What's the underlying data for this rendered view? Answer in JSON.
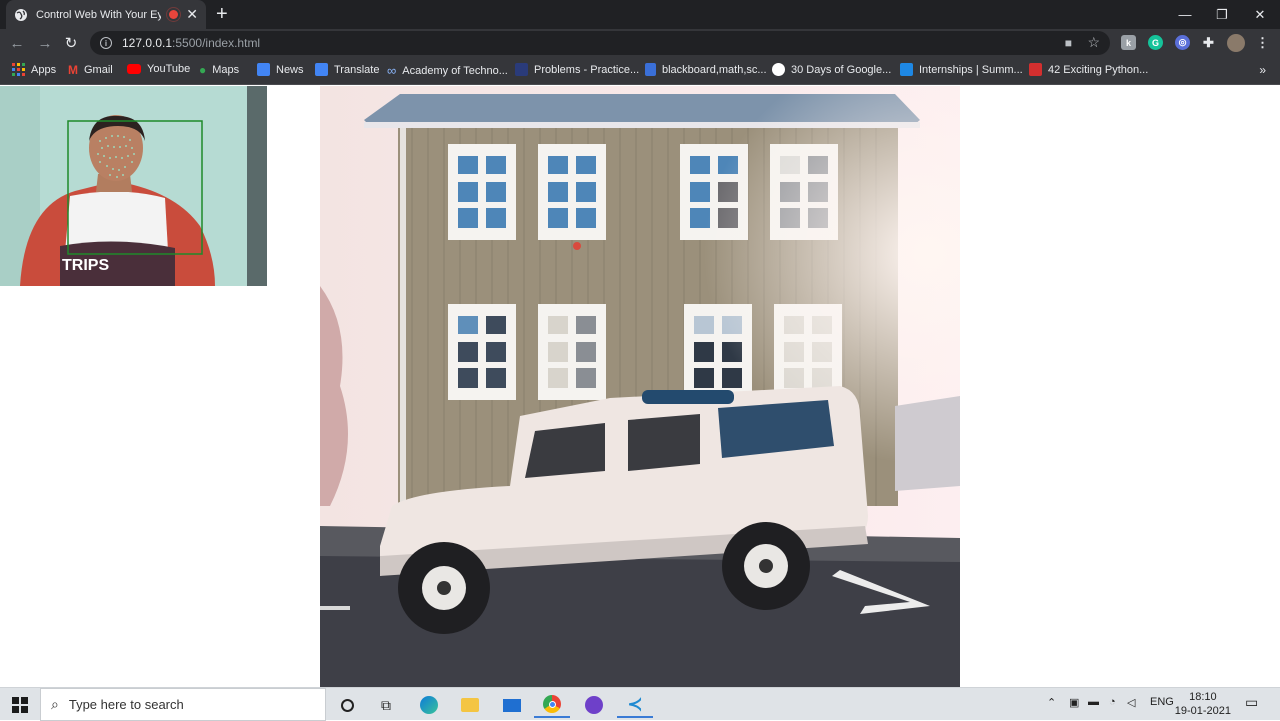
{
  "browser": {
    "tab_title": "Control Web With Your Eyes",
    "url_host": "127.0.0.1",
    "url_rest": ":5500/index.html",
    "bookmarks": [
      {
        "label": "Apps",
        "color": "#4285f4"
      },
      {
        "label": "Gmail",
        "color": "#ea4335"
      },
      {
        "label": "YouTube",
        "color": "#ff0000"
      },
      {
        "label": "Maps",
        "color": "#34a853"
      },
      {
        "label": "News",
        "color": "#4285f4"
      },
      {
        "label": "Translate",
        "color": "#4285f4"
      },
      {
        "label": "Academy of Techno...",
        "color": "#5b7bd5"
      },
      {
        "label": "Problems - Practice...",
        "color": "#2a3b7a"
      },
      {
        "label": "blackboard,math,sc...",
        "color": "#3a6fd8"
      },
      {
        "label": "30 Days of Google...",
        "color": "#ffffff"
      },
      {
        "label": "Internships | Summ...",
        "color": "#1e88e5"
      },
      {
        "label": "42 Exciting Python...",
        "color": "#d32f2f"
      }
    ],
    "more_bookmarks": "»"
  },
  "page": {
    "webcam_label": "webcam feed with face mesh",
    "photo_label": "house with white SUV"
  },
  "taskbar": {
    "search_placeholder": "Type here to search",
    "language": "ENG",
    "time": "18:10",
    "date": "19-01-2021"
  }
}
